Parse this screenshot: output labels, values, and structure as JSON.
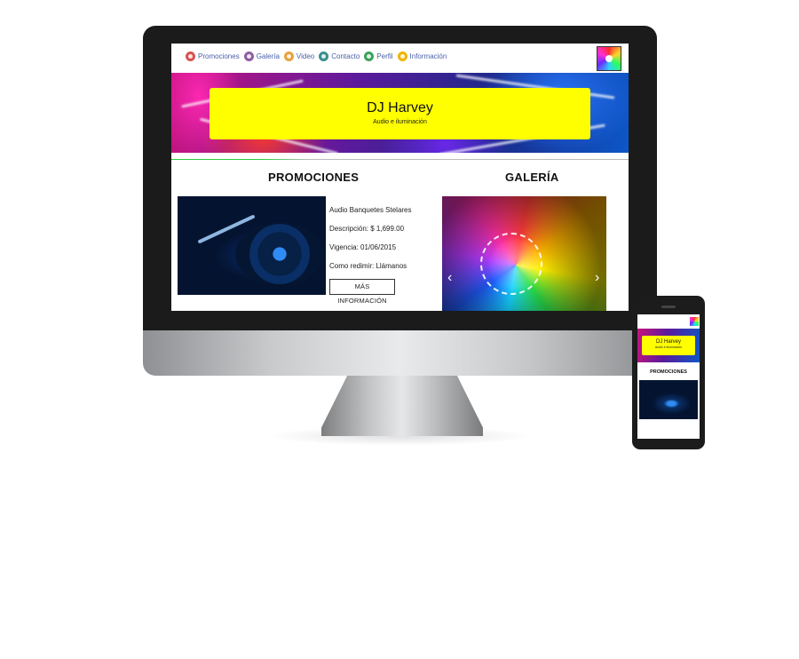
{
  "nav": {
    "items": [
      {
        "label": "Promociones",
        "icon": "prohibited-icon",
        "color": "#d9534f"
      },
      {
        "label": "Galería",
        "icon": "image-icon",
        "color": "#8e5ea2"
      },
      {
        "label": "Video",
        "icon": "play-icon",
        "color": "#e8a13b"
      },
      {
        "label": "Contacto",
        "icon": "globe-icon",
        "color": "#3a8f8f"
      },
      {
        "label": "Perfil",
        "icon": "user-icon",
        "color": "#3aa35a"
      },
      {
        "label": "Información",
        "icon": "info-icon",
        "color": "#f0b400"
      }
    ]
  },
  "banner": {
    "title": "DJ Harvey",
    "subtitle": "Audio e iluminación",
    "box_color": "#ffff00"
  },
  "promociones": {
    "heading": "PROMOCIONES",
    "name": "Audio Banquetes Stelares",
    "description": "Descripción: $ 1,699.00",
    "validity": "Vigencia: 01/06/2015",
    "redeem": "Como redimir: Llámanos",
    "button": "MÁS INFORMACIÓN"
  },
  "galeria": {
    "heading": "GALERÍA",
    "prev_icon": "chevron-left-icon",
    "next_icon": "chevron-right-icon"
  },
  "phone": {
    "title": "DJ Harvey",
    "subtitle": "Audio e iluminación",
    "heading": "PROMOCIONES"
  }
}
